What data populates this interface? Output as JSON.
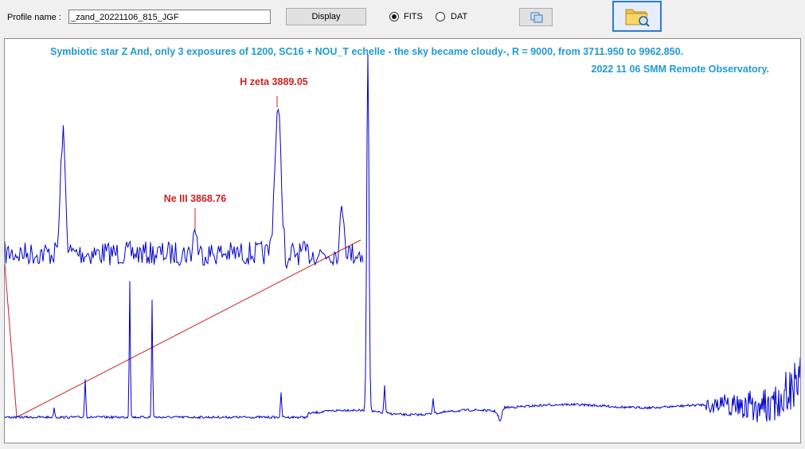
{
  "toolbar": {
    "profile_label": "Profile name :",
    "profile_value": "_zand_20221106_815_JGF",
    "display_label": "Display",
    "radio_fits": "FITS",
    "radio_dat": "DAT",
    "selected_format": "FITS",
    "swap_icon": "copy-windows-icon",
    "open_icon": "folder-search-icon"
  },
  "plot": {
    "title_line1": "Symbiotic star Z And,  only 3 exposures of 1200, SC16 + NOU_T echelle - the sky became cloudy-, R = 9000, from 3711.950 to 9962.850.",
    "title_line2": "2022 11 06  SMM Remote Observatory.",
    "annotations": [
      {
        "label": "H zeta 3889.05"
      },
      {
        "label": "Ne III 3868.76"
      }
    ],
    "colors": {
      "spectrum": "#0000cc",
      "annotation": "#cc2222",
      "title": "#1e9ad6",
      "zoom_line": "#cc2222"
    }
  },
  "chart_data": {
    "type": "line",
    "title": "Symbiotic star Z And,  only 3 exposures of 1200, SC16 + NOU_T echelle - the sky became cloudy-, R = 9000, from 3711.950 to 9962.850.",
    "xlabel": "",
    "ylabel": "",
    "xlim": [
      3711.95,
      9962.85
    ],
    "grid": false,
    "series": [
      {
        "values_description_omitted": true
      }
    ]
  }
}
